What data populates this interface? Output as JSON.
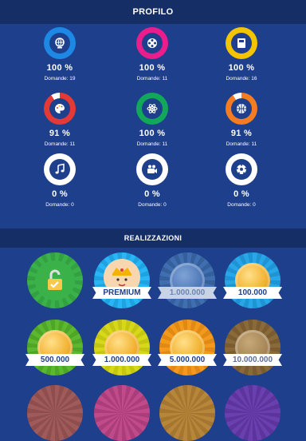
{
  "header": {
    "title": "PROFILO"
  },
  "categories": [
    {
      "percent": "100 %",
      "questions": "Domande: 19",
      "icon": "globe-icon",
      "color": "#1e88e5"
    },
    {
      "percent": "100 %",
      "questions": "Domande: 11",
      "icon": "film-reel-icon",
      "color": "#e91e8c"
    },
    {
      "percent": "100 %",
      "questions": "Domande: 16",
      "icon": "book-icon",
      "color": "#f5c400"
    },
    {
      "percent": "91 %",
      "questions": "Domande: 11",
      "icon": "palette-icon",
      "color": "#e53935"
    },
    {
      "percent": "100 %",
      "questions": "Domande: 11",
      "icon": "atom-icon",
      "color": "#12a85a"
    },
    {
      "percent": "91 %",
      "questions": "Domande: 11",
      "icon": "basketball-icon",
      "color": "#f57c20"
    },
    {
      "percent": "0 %",
      "questions": "Domande: 0",
      "icon": "music-note-icon",
      "color": "#ffffff"
    },
    {
      "percent": "0 %",
      "questions": "Domande: 0",
      "icon": "video-camera-icon",
      "color": "#ffffff"
    },
    {
      "percent": "0 %",
      "questions": "Domande: 0",
      "icon": "soccer-ball-icon",
      "color": "#ffffff"
    }
  ],
  "achievements": {
    "title": "REALIZZAZIONI",
    "items": [
      {
        "label": "",
        "icon": "padlock-open-icon",
        "color": "#3bb14a",
        "achieved": true
      },
      {
        "label": "PREMIUM",
        "icon": "king-icon",
        "color": "#29b6f6",
        "achieved": true
      },
      {
        "label": "1.000.000",
        "icon": "coin-icon",
        "color": "#3f6fb0",
        "achieved": false
      },
      {
        "label": "100.000",
        "icon": "coin-icon",
        "color": "#29a6e8",
        "achieved": true
      },
      {
        "label": "500.000",
        "icon": "coin-icon",
        "color": "#5cb82e",
        "achieved": true
      },
      {
        "label": "1.000.000",
        "icon": "coin-icon",
        "color": "#d7d81a",
        "achieved": true
      },
      {
        "label": "5.000.000",
        "icon": "coin-icon",
        "color": "#f39a1c",
        "achieved": true
      },
      {
        "label": "10.000.000",
        "icon": "coin-icon",
        "color": "#8b6a3a",
        "achieved": false
      }
    ]
  }
}
